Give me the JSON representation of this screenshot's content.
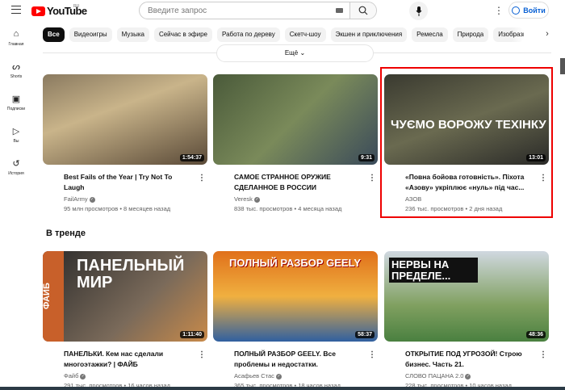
{
  "header": {
    "logo_text": "YouTube",
    "region": "RU",
    "search_placeholder": "Введите запрос",
    "sign_in": "Войти"
  },
  "sidebar": [
    {
      "label": "Главная",
      "icon": "home-icon"
    },
    {
      "label": "Shorts",
      "icon": "shorts-icon"
    },
    {
      "label": "Подписки",
      "icon": "subscriptions-icon"
    },
    {
      "label": "Вы",
      "icon": "you-icon"
    },
    {
      "label": "История",
      "icon": "history-icon"
    }
  ],
  "chips": [
    "Все",
    "Видеоигры",
    "Музыка",
    "Сейчас в эфире",
    "Работа по дереву",
    "Скетч-шоу",
    "Экшен и приключения",
    "Ремесла",
    "Природа",
    "Изобразительное"
  ],
  "more_label": "Ещё",
  "section_title": "В тренде",
  "videos": [
    {
      "title": "Best Fails of the Year | Try Not To Laugh",
      "channel": "FailArmy",
      "verified": true,
      "stats": "95 млн просмотров • 8 месяцев назад",
      "duration": "1:54:37",
      "thumb_text": ""
    },
    {
      "title": "САМОЕ СТРАННОЕ ОРУЖИЕ СДЕЛАННОЕ В РОССИИ",
      "channel": "Veresk",
      "verified": true,
      "stats": "838 тыс. просмотров • 4 месяца назад",
      "duration": "9:31",
      "thumb_text": ""
    },
    {
      "title": "«Повна бойова готовність». Піхота «Азову» укріплює «нуль» під час...",
      "channel": "АЗОВ",
      "verified": false,
      "stats": "236 тыс. просмотров • 2 дня назад",
      "duration": "13:01",
      "thumb_text": "ЧУЄМО ВОРОЖУ ТЕХІНКУ"
    },
    {
      "title": "ПАНЕЛЬКИ. Кем нас сделали многоэтажки? | ФАЙБ",
      "channel": "Файб",
      "verified": true,
      "stats": "291 тыс. просмотров • 16 часов назад",
      "duration": "1:11:40",
      "thumb_text": "ПАНЕЛЬНЫЙ МИР",
      "thumb_side": "ФАЙБ"
    },
    {
      "title": "ПОЛНЫЙ РАЗБОР GEELY. Все проблемы и недостатки.",
      "channel": "Асафьев Стас",
      "verified": true,
      "stats": "365 тыс. просмотров • 18 часов назад",
      "duration": "58:37",
      "thumb_text": "ПОЛНЫЙ РАЗБОР GEELY"
    },
    {
      "title": "ОТКРЫТИЕ ПОД УГРОЗОЙ! Строю бизнес. Часть 21.",
      "channel": "СЛОВО ПАЦАНА 2.0",
      "verified": true,
      "stats": "228 тыс. просмотров • 10 часов назад",
      "duration": "48:36",
      "thumb_text": "НЕРВЫ НА ПРЕДЕЛЕ..."
    }
  ]
}
